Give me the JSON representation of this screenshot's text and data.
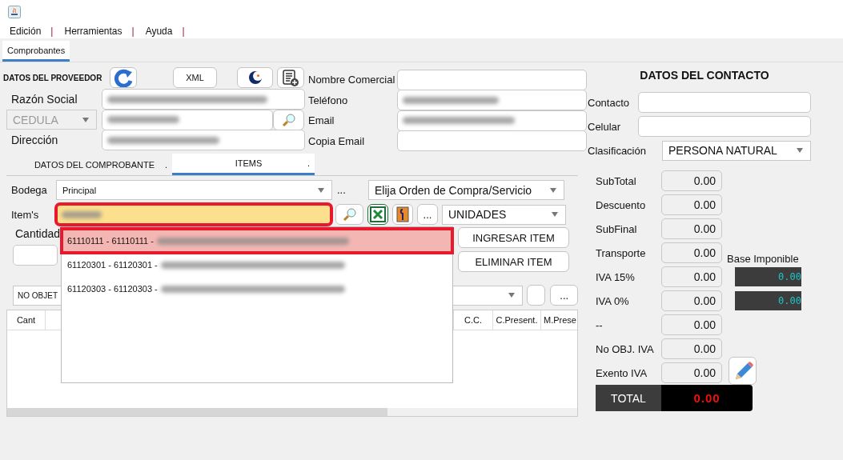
{
  "menu": [
    {
      "label": "Edición",
      "separator": "|"
    },
    {
      "label": "Herramientas",
      "separator": "|"
    },
    {
      "label": "Ayuda",
      "separator": "|"
    }
  ],
  "tabs": [
    {
      "label": "Comprobantes",
      "selected": true
    }
  ],
  "proveedor": {
    "title": "DATOS DEL PROVEEDOR",
    "xml_button": "XML",
    "razon_social": {
      "label": "Razón Social",
      "obscured": true
    },
    "id_type": {
      "value": "CEDULA",
      "disabled": true
    },
    "identificacion": {
      "obscured": true
    },
    "direccion": {
      "label": "Dirección",
      "obscured": true
    }
  },
  "comercial_fields": [
    {
      "label": "Nombre Comercial",
      "obscured": false
    },
    {
      "label": "Teléfono",
      "obscured": true
    },
    {
      "label": "Email",
      "obscured": true
    },
    {
      "label": "Copia Email",
      "obscured": false
    }
  ],
  "contacto": {
    "title": "DATOS DEL CONTACTO",
    "fields": [
      {
        "label": "Contacto"
      },
      {
        "label": "Celular"
      }
    ],
    "clasificacion": {
      "label": "Clasificación",
      "value": "PERSONA NATURAL"
    }
  },
  "subtabs": [
    {
      "label": "DATOS DEL COMPROBANTE",
      "mark": ".",
      "selected": false
    },
    {
      "label": "ITEMS",
      "mark": ".",
      "selected": true
    }
  ],
  "items": {
    "bodega": {
      "label": "Bodega",
      "value": "Principal"
    },
    "bodega_more": "...",
    "orden": {
      "value": "Elija Orden de Compra/Servicio"
    },
    "item": {
      "label": "Item's",
      "obscured": true,
      "highlighted": true
    },
    "more_button": "...",
    "unidad": {
      "value": "UNIDADES"
    },
    "cantidad": {
      "label": "Cantidad"
    },
    "ingresar_button": "INGRESAR ITEM",
    "eliminar_button": "ELIMINAR ITEM",
    "tax_select": {
      "value": "NO OBJET"
    },
    "tax_more": "...",
    "table": {
      "columns": [
        {
          "label": "Cant"
        },
        {
          "label": "C.C."
        },
        {
          "label": "C.Present."
        },
        {
          "label": "M.Prese"
        }
      ]
    }
  },
  "suggestions": [
    {
      "code": "61110111 - 61110111 -",
      "selected": true,
      "highlighted": true
    },
    {
      "code": "61120301 - 61120301 -",
      "selected": false,
      "highlighted": false
    },
    {
      "code": "61120303 - 61120303 -",
      "selected": false,
      "highlighted": false
    }
  ],
  "totals": {
    "rows": [
      {
        "label": "SubTotal",
        "value": "0.00"
      },
      {
        "label": "Descuento",
        "value": "0.00"
      },
      {
        "label": "SubFinal",
        "value": "0.00"
      },
      {
        "label": "Transporte",
        "value": "0.00"
      },
      {
        "label": "IVA 15%",
        "value": "0.00"
      },
      {
        "label": "IVA 0%",
        "value": "0.00"
      },
      {
        "label": "--",
        "value": "0.00"
      },
      {
        "label": "No OBJ. IVA",
        "value": "0.00"
      },
      {
        "label": "Exento IVA",
        "value": "0.00"
      }
    ],
    "base_imponible": {
      "label": "Base Imponible",
      "values": [
        "0.00",
        "0.00"
      ]
    },
    "total": {
      "label": "TOTAL",
      "value": "0.00"
    }
  }
}
